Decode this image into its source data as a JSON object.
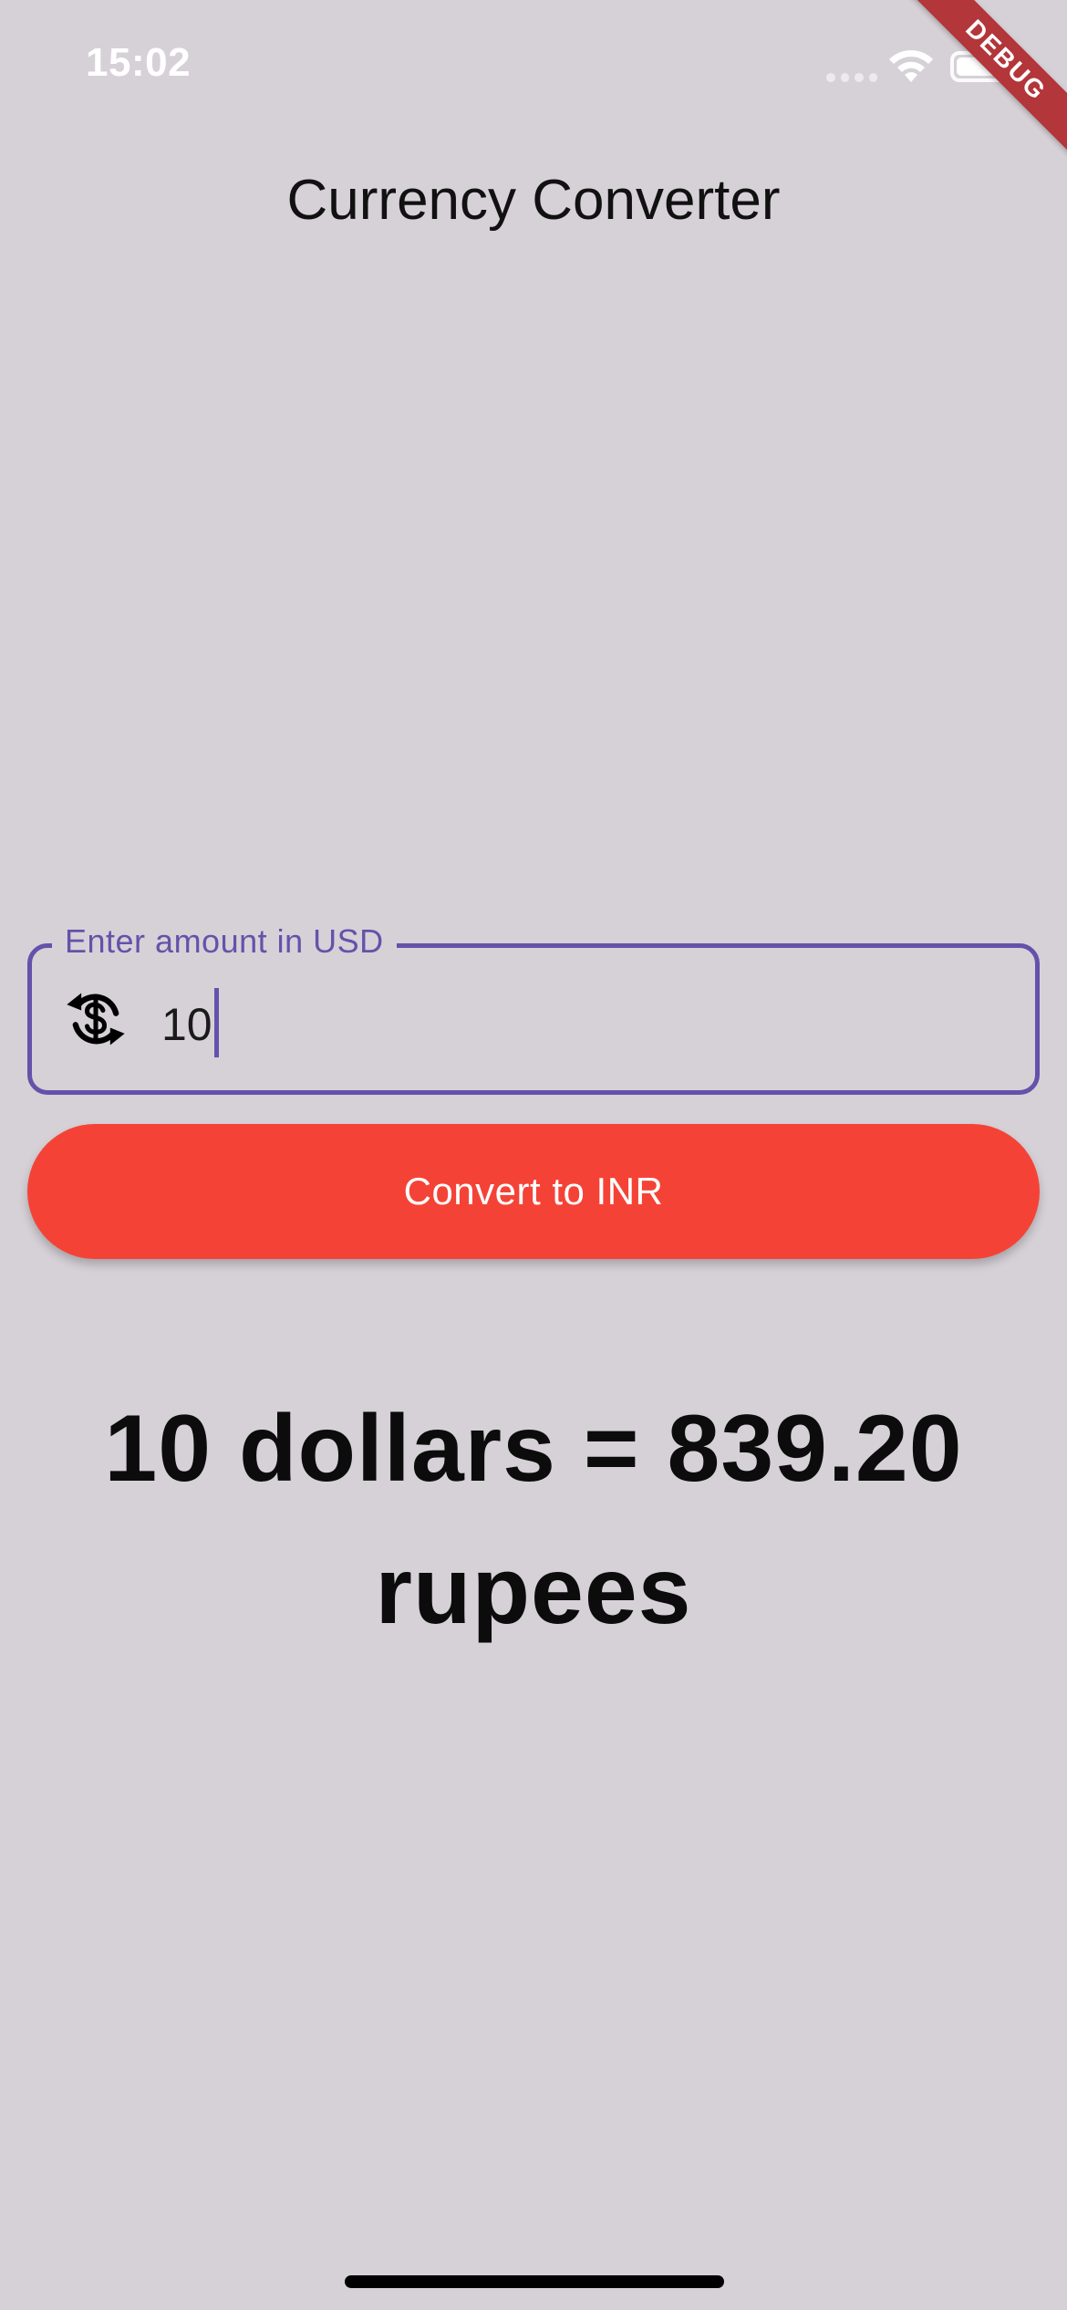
{
  "status_bar": {
    "time": "15:02",
    "icons": [
      "signal-icon",
      "wifi-icon",
      "battery-icon"
    ]
  },
  "debug_banner": {
    "label": "DEBUG",
    "color": "#b3363a"
  },
  "app": {
    "title": "Currency Converter"
  },
  "amount_field": {
    "label": "Enter amount in USD",
    "value": "10",
    "icon": "currency-exchange-icon",
    "accent_color": "#6452aa"
  },
  "convert_button": {
    "label": "Convert to INR",
    "color": "#f44336"
  },
  "result": {
    "text": "10 dollars = 839.20 rupees"
  }
}
